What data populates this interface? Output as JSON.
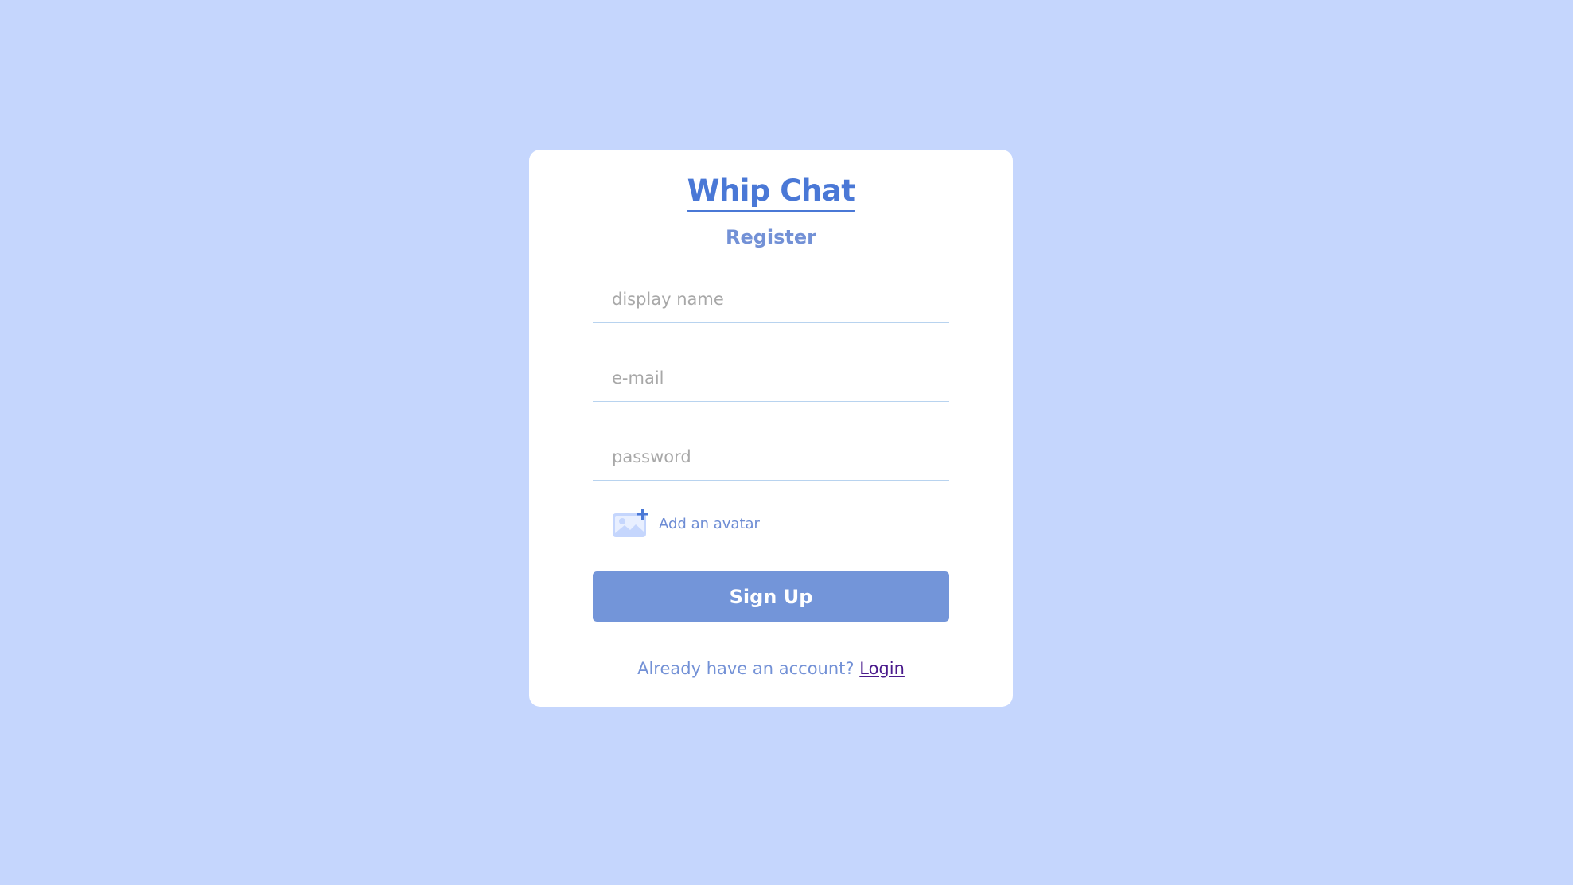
{
  "app": {
    "title": "Whip Chat",
    "subtitle": "Register"
  },
  "form": {
    "display_name": {
      "placeholder": "display name",
      "value": ""
    },
    "email": {
      "placeholder": "e-mail",
      "value": ""
    },
    "password": {
      "placeholder": "password",
      "value": ""
    },
    "avatar": {
      "label": "Add an avatar",
      "icon": "image-add-icon"
    },
    "submit_label": "Sign Up"
  },
  "footer": {
    "prompt": "Already have an account?",
    "login_label": "Login"
  },
  "colors": {
    "background": "#c5d6fd",
    "card": "#ffffff",
    "accent": "#4a78d6",
    "button": "#7395d9",
    "link": "#4a1a8c"
  }
}
